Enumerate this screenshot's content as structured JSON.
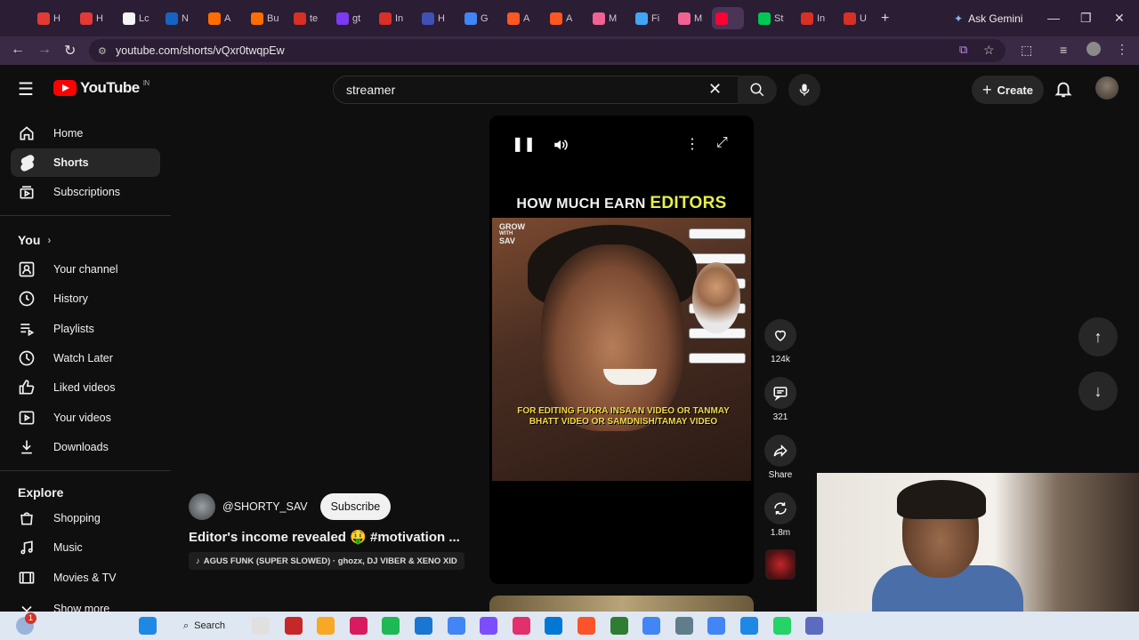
{
  "browser": {
    "tabs": [
      {
        "label": "H",
        "color": "#e53935"
      },
      {
        "label": "H",
        "color": "#e53935"
      },
      {
        "label": "Lc",
        "color": "#f5f5f5"
      },
      {
        "label": "N",
        "color": "#1565c0"
      },
      {
        "label": "A",
        "color": "#ff6d00"
      },
      {
        "label": "Bu",
        "color": "#ff6d00"
      },
      {
        "label": "te",
        "color": "#d93025"
      },
      {
        "label": "gt",
        "color": "#7e3af2"
      },
      {
        "label": "In",
        "color": "#d93025"
      },
      {
        "label": "H",
        "color": "#3f51b5"
      },
      {
        "label": "G",
        "color": "#4285f4"
      },
      {
        "label": "A",
        "color": "#ff5722"
      },
      {
        "label": "A",
        "color": "#ff5722"
      },
      {
        "label": "M",
        "color": "#f06292"
      },
      {
        "label": "Fi",
        "color": "#42a5f5"
      },
      {
        "label": "M",
        "color": "#f06292"
      },
      {
        "label": "",
        "color": "#ff0033"
      },
      {
        "label": "St",
        "color": "#00c853"
      },
      {
        "label": "In",
        "color": "#d93025"
      },
      {
        "label": "U",
        "color": "#d93025"
      }
    ],
    "gemini_label": "Ask Gemini",
    "url": "youtube.com/shorts/vQxr0twqpEw"
  },
  "header": {
    "logo_text": "YouTube",
    "logo_region": "IN",
    "search_value": "streamer",
    "create_label": "Create"
  },
  "sidebar": {
    "main": [
      {
        "label": "Home",
        "icon": "home-icon"
      },
      {
        "label": "Shorts",
        "icon": "shorts-icon",
        "active": true
      },
      {
        "label": "Subscriptions",
        "icon": "subscriptions-icon"
      }
    ],
    "you_heading": "You",
    "you_items": [
      {
        "label": "Your channel",
        "icon": "channel-icon"
      },
      {
        "label": "History",
        "icon": "history-icon"
      },
      {
        "label": "Playlists",
        "icon": "playlists-icon"
      },
      {
        "label": "Watch Later",
        "icon": "watch-later-icon"
      },
      {
        "label": "Liked videos",
        "icon": "like-icon"
      },
      {
        "label": "Your videos",
        "icon": "your-videos-icon"
      },
      {
        "label": "Downloads",
        "icon": "download-icon"
      }
    ],
    "explore_heading": "Explore",
    "explore_items": [
      {
        "label": "Shopping",
        "icon": "shopping-icon"
      },
      {
        "label": "Music",
        "icon": "music-icon"
      },
      {
        "label": "Movies & TV",
        "icon": "movies-icon"
      },
      {
        "label": "Show more",
        "icon": "chevron-down-icon"
      }
    ]
  },
  "short": {
    "headline_white": "HOW MUCH EARN",
    "headline_accent": "EDITORS",
    "watermark_line1": "GROW",
    "watermark_line2": "WITH",
    "watermark_line3": "SAV",
    "caption": "FOR EDITING FUKRA INSAAN VIDEO OR TANMAY BHATT VIDEO OR SAMDNISH/TAMAY VIDEO",
    "channel": "@SHORTY_SAV",
    "subscribe_label": "Subscribe",
    "title": "Editor's income revealed 🤑 #motivation ...",
    "music": "AGUS FUNK (SUPER SLOWED) · ghozx, DJ VIBER & XENO XID"
  },
  "actions": {
    "likes": "124k",
    "comments": "321",
    "share": "Share",
    "remix": "1.8m"
  },
  "taskbar": {
    "search_label": "Search",
    "notification_count": "1"
  }
}
